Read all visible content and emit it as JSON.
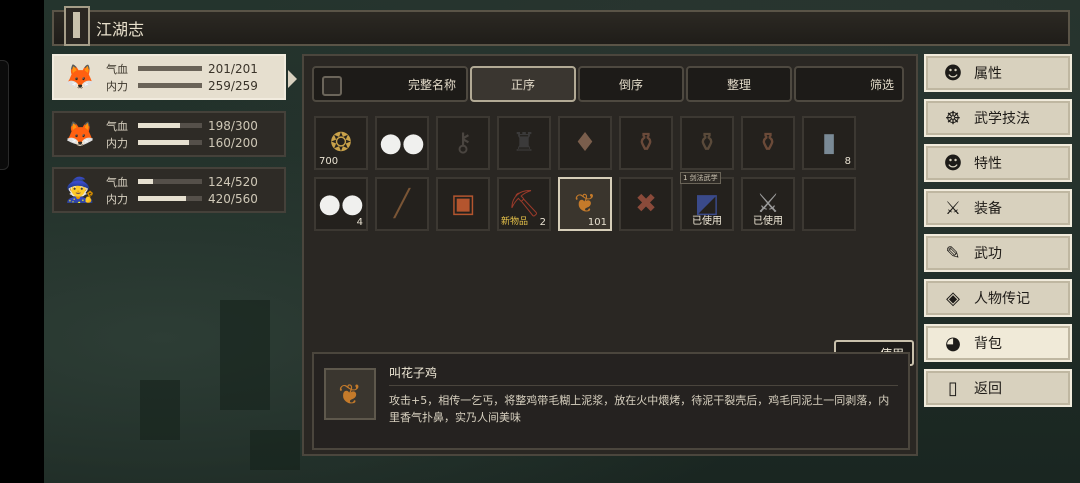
{
  "title": "江湖志",
  "party": [
    {
      "hp_label": "气血",
      "hp": "201/201",
      "hp_frac": 1.0,
      "mp_label": "内力",
      "mp": "259/259",
      "mp_frac": 1.0,
      "icon": "portrait-icon",
      "active": true
    },
    {
      "hp_label": "气血",
      "hp": "198/300",
      "hp_frac": 0.66,
      "mp_label": "内力",
      "mp": "160/200",
      "mp_frac": 0.8,
      "icon": "portrait-icon",
      "active": false
    },
    {
      "hp_label": "气血",
      "hp": "124/520",
      "hp_frac": 0.24,
      "mp_label": "内力",
      "mp": "420/560",
      "mp_frac": 0.75,
      "icon": "portrait-icon",
      "active": false
    }
  ],
  "tabs": [
    "完整名称",
    "正序",
    "倒序",
    "整理",
    "筛选"
  ],
  "items": [
    {
      "icon": "coins-icon",
      "glyph": "❂",
      "color": "#c9a24a",
      "count": "700",
      "count_pos": "left"
    },
    {
      "icon": "rice-buns-icon",
      "glyph": "●●",
      "color": "#f0f0ee"
    },
    {
      "icon": "key-icon",
      "glyph": "⚷",
      "color": "#4a4540"
    },
    {
      "icon": "robe-icon",
      "glyph": "♜",
      "color": "#3b3a3a"
    },
    {
      "icon": "incense-icon",
      "glyph": "♦",
      "color": "#7a5e4c"
    },
    {
      "icon": "wine-jar-icon",
      "glyph": "⚱",
      "color": "#6a4a3a"
    },
    {
      "icon": "wine-jar-icon",
      "glyph": "⚱",
      "color": "#5a4a3a"
    },
    {
      "icon": "jar-with-stick-icon",
      "glyph": "⚱",
      "color": "#6b4a38"
    },
    {
      "icon": "bottle-icon",
      "glyph": "▮",
      "color": "#7a8a96",
      "count": "8"
    },
    {
      "icon": "rice-buns-icon",
      "glyph": "●●",
      "color": "#f0f0ee",
      "count": "4"
    },
    {
      "icon": "staff-icon",
      "glyph": "╱",
      "color": "#7a5535"
    },
    {
      "icon": "book-icon",
      "glyph": "▣",
      "color": "#b4552e"
    },
    {
      "icon": "pickaxe-icon",
      "glyph": "⛏",
      "color": "#9a3a2a",
      "new": "新物品",
      "count": "2"
    },
    {
      "icon": "roast-chicken-icon",
      "glyph": "❦",
      "color": "#c47a2a",
      "count": "101",
      "selected": true
    },
    {
      "icon": "crossed-tools-icon",
      "glyph": "✖",
      "color": "#8a4a3a"
    },
    {
      "icon": "manual-icon",
      "glyph": "◩",
      "color": "#3a4a8a",
      "badge": "已使用",
      "tag": "1 剑法武学"
    },
    {
      "icon": "sword-icon",
      "glyph": "⚔",
      "color": "#9a9a9a",
      "badge": "已使用"
    },
    {
      "icon": "empty-slot",
      "glyph": "",
      "color": "#000"
    }
  ],
  "detail": {
    "name": "叫花子鸡",
    "icon": "roast-chicken-icon",
    "text": "攻击+5，相传一乞丐，将整鸡带毛糊上泥浆，放在火中煨烤，待泥干裂壳后，鸡毛同泥土一同剥落，内里香气扑鼻，实乃人间美味",
    "use_label": "使用"
  },
  "menu": [
    {
      "label": "属性",
      "icon": "person-icon",
      "glyph": "☻"
    },
    {
      "label": "武学技法",
      "icon": "meditate-icon",
      "glyph": "☸"
    },
    {
      "label": "特性",
      "icon": "trait-icon",
      "glyph": "☻"
    },
    {
      "label": "装备",
      "icon": "sword-icon",
      "glyph": "⚔"
    },
    {
      "label": "武功",
      "icon": "scroll-icon",
      "glyph": "✎"
    },
    {
      "label": "人物传记",
      "icon": "diamond-icon",
      "glyph": "◈"
    },
    {
      "label": "背包",
      "icon": "bag-icon",
      "glyph": "◕",
      "active": true
    },
    {
      "label": "返回",
      "icon": "exit-icon",
      "glyph": "▯"
    }
  ]
}
